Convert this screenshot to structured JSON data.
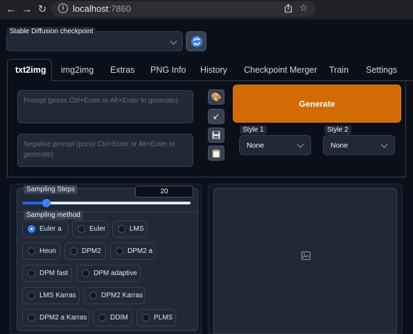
{
  "browser": {
    "url_host": "localhost",
    "url_port": ":7860",
    "back_icon": "arrow-left-icon",
    "forward_icon": "arrow-right-icon",
    "reload_icon": "reload-icon",
    "info_icon": "info-icon",
    "share_icon": "share-icon",
    "bookmark_icon": "star-icon"
  },
  "checkpoint": {
    "label": "Stable Diffusion checkpoint",
    "value": "",
    "refresh_icon": "refresh-icon"
  },
  "tabs": [
    {
      "label": "txt2img",
      "active": true
    },
    {
      "label": "img2img"
    },
    {
      "label": "Extras"
    },
    {
      "label": "PNG Info"
    },
    {
      "label": "History"
    },
    {
      "label": "Checkpoint Merger"
    },
    {
      "label": "Train"
    },
    {
      "label": "Settings"
    }
  ],
  "prompt": {
    "placeholder": "Prompt (press Ctrl+Enter or Alt+Enter to generate)"
  },
  "negative_prompt": {
    "placeholder": "Negative prompt (press Ctrl+Enter or Alt+Enter to generate)"
  },
  "tools": {
    "palette_icon": "palette-icon",
    "arrow_icon": "arrow-down-left-icon",
    "save_icon": "floppy-disk-icon",
    "clipboard_icon": "clipboard-icon"
  },
  "generate": {
    "label": "Generate",
    "color": "#d26b03"
  },
  "styles": [
    {
      "label": "Style 1",
      "value": "None"
    },
    {
      "label": "Style 2",
      "value": "None"
    }
  ],
  "sampling_steps": {
    "label": "Sampling Steps",
    "value": "20",
    "fraction": 0.14
  },
  "sampling_method": {
    "label": "Sampling method",
    "selected": "Euler a",
    "options": [
      "Euler a",
      "Euler",
      "LMS",
      "Heun",
      "DPM2",
      "DPM2 a",
      "DPM fast",
      "DPM adaptive",
      "LMS Karras",
      "DPM2 Karras",
      "DPM2 a Karras",
      "DDIM",
      "PLMS"
    ]
  },
  "output": {
    "image_icon": "image-icon"
  },
  "colors": {
    "background": "#0b0f19",
    "accent": "#3b82f6"
  }
}
